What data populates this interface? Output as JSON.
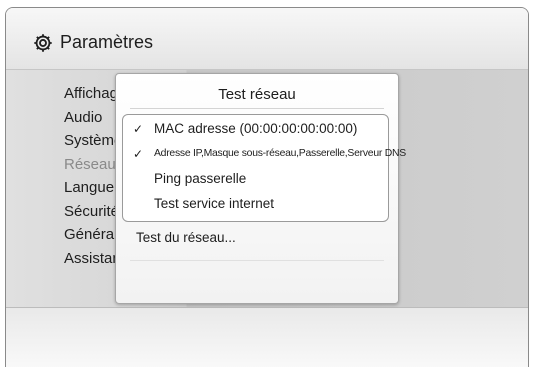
{
  "header": {
    "title": "Paramètres",
    "icon": "gear-icon"
  },
  "menu": {
    "items": [
      {
        "label": "Affichage"
      },
      {
        "label": "Audio"
      },
      {
        "label": "Système"
      },
      {
        "label": "Réseau"
      },
      {
        "label": "Langue"
      },
      {
        "label": "Sécurité"
      },
      {
        "label": "Général"
      },
      {
        "label": "Assistance"
      }
    ]
  },
  "dialog": {
    "title": "Test réseau",
    "options": [
      {
        "check": "✓",
        "label": "MAC adresse (00:00:00:00:00:00)"
      },
      {
        "check": "✓",
        "label": "Adresse IP,Masque sous-réseau,Passerelle,Serveur DNS"
      },
      {
        "check": "",
        "label": "Ping passerelle"
      },
      {
        "check": "",
        "label": "Test service internet"
      }
    ],
    "action": "Test du réseau..."
  }
}
